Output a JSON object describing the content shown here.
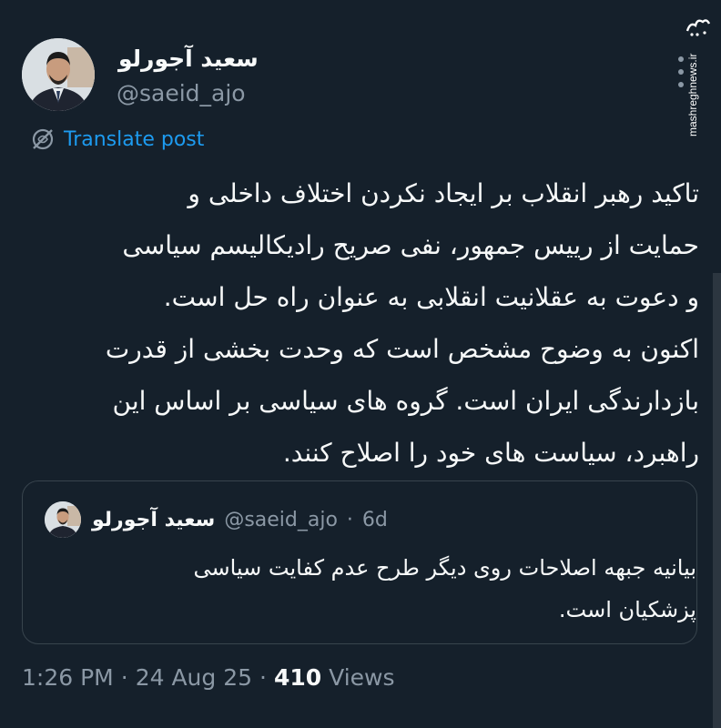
{
  "author": {
    "name": "سعید آجورلو",
    "handle": "@saeid_ajo"
  },
  "watermark": {
    "text": "mashreghnews.ir",
    "logo_text": "مشرق"
  },
  "translate_label": "Translate post",
  "tweet": {
    "lines": [
      "تاکید رهبر انقلاب بر ایجاد نکردن اختلاف داخلی و",
      "حمایت از رییس جمهور، نفی صریح رادیکالیسم سیاسی",
      "و دعوت به عقلانیت انقلابی به عنوان راه حل است.",
      "اکنون به وضوح مشخص است که وحدت بخشی از قدرت",
      "بازدارندگی ایران است. گروه های سیاسی بر اساس این",
      "راهبرد، سیاست های خود را اصلاح کنند."
    ]
  },
  "quote": {
    "name": "سعید آجورلو",
    "handle": "@saeid_ajo",
    "separator": "·",
    "age": "6d",
    "lines": [
      "بیانیه جبهه اصلاحات روی دیگر طرح عدم کفایت سیاسی",
      "پزشکیان است."
    ]
  },
  "footer": {
    "time": "1:26 PM",
    "separator": "·",
    "date": "24 Aug 25",
    "views_count": "410",
    "views_label": "Views"
  },
  "colors": {
    "background": "#15202b",
    "text": "#f7f9f9",
    "muted": "#8b98a5",
    "accent": "#1d9bf0",
    "border": "#38444d"
  },
  "icons": {
    "translate": "globe-slash-icon",
    "more": "more-vertical-icon"
  }
}
